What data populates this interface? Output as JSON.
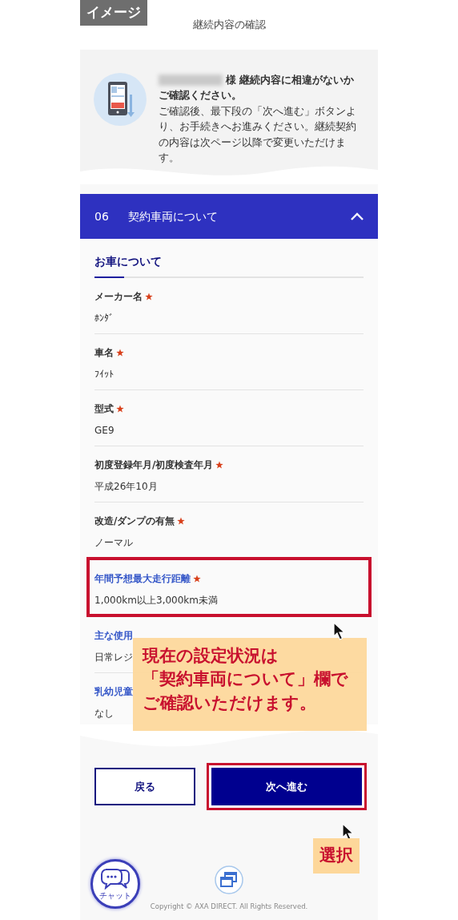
{
  "badge": "イメージ",
  "header": {
    "title": "継続内容の確認"
  },
  "notice": {
    "heading": [
      "様 継続内容に相違がないか",
      "ご確認ください。"
    ],
    "body": "ご確認後、最下段の「次へ進む」ボタンより、お手続きへお進みください。継続契約の内容は次ページ以降で変更いただけます。"
  },
  "section": {
    "number": "06",
    "title": "契約車両について",
    "expanded": true
  },
  "subsection": "お車について",
  "fields": [
    {
      "label": "メーカー名",
      "required": true,
      "value": "ﾎﾝﾀﾞ",
      "accent": false,
      "framed": false
    },
    {
      "label": "車名",
      "required": true,
      "value": "ﾌｲｯﾄ",
      "accent": false,
      "framed": false
    },
    {
      "label": "型式",
      "required": true,
      "value": "GE9",
      "accent": false,
      "framed": false
    },
    {
      "label": "初度登録年月/初度検査年月",
      "required": true,
      "value": "平成26年10月",
      "accent": false,
      "framed": false
    },
    {
      "label": "改造/ダンプの有無",
      "required": true,
      "value": "ノーマル",
      "accent": false,
      "framed": false
    },
    {
      "label": "年間予想最大走行距離",
      "required": true,
      "value": "1,000km以上3,000km未満",
      "accent": true,
      "framed": true
    },
    {
      "label": "主な使用",
      "required": false,
      "value": "日常レジ",
      "accent": true,
      "framed": false
    },
    {
      "label": "乳幼児童",
      "required": false,
      "value": "なし",
      "accent": true,
      "framed": false
    }
  ],
  "callout": {
    "lines": [
      "現在の設定状況は",
      "「契約車両について」欄で",
      "ご確認いただけます。"
    ]
  },
  "buttons": [
    {
      "label": "戻る",
      "kind": "secondary",
      "framed": false
    },
    {
      "label": "次へ進む",
      "kind": "primary",
      "framed": true
    }
  ],
  "select_label": "選択",
  "chat": {
    "label": "チャット"
  },
  "copyright": "Copyright © AXA DIRECT. All Rights Reserved."
}
